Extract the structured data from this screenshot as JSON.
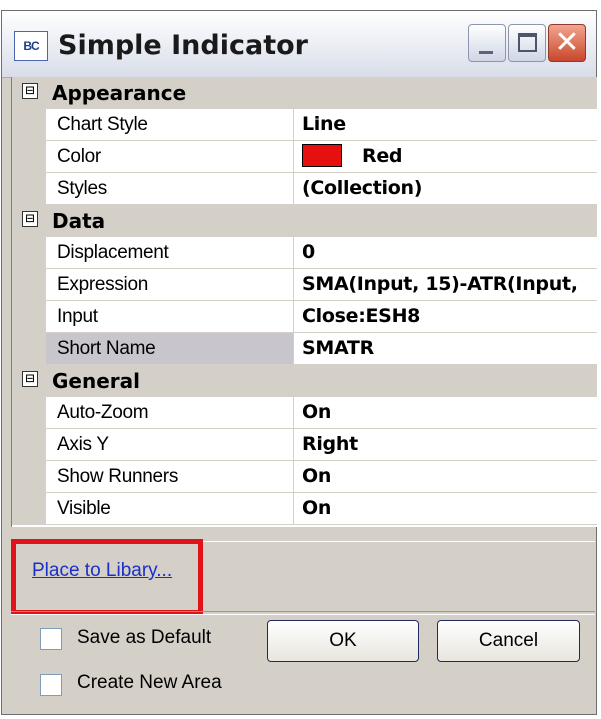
{
  "window": {
    "title": "Simple Indicator",
    "icon_text": "BC",
    "icon": "indicator-app-icon"
  },
  "grid": {
    "categories": [
      {
        "label": "Appearance",
        "expander": "⊟",
        "properties": [
          {
            "name": "Chart Style",
            "value": "Line"
          },
          {
            "name": "Color",
            "value": "Red",
            "swatch": "#e61010"
          },
          {
            "name": "Styles",
            "value": "(Collection)"
          }
        ]
      },
      {
        "label": "Data",
        "expander": "⊟",
        "properties": [
          {
            "name": "Displacement",
            "value": "0"
          },
          {
            "name": "Expression",
            "value": "SMA(Input, 15)-ATR(Input,"
          },
          {
            "name": "Input",
            "value": "Close:ESH8"
          },
          {
            "name": "Short Name",
            "value": "SMATR",
            "selected": true
          }
        ]
      },
      {
        "label": "General",
        "expander": "⊟",
        "properties": [
          {
            "name": "Auto-Zoom",
            "value": "On"
          },
          {
            "name": "Axis Y",
            "value": "Right"
          },
          {
            "name": "Show Runners",
            "value": "On"
          },
          {
            "name": "Visible",
            "value": "On"
          }
        ]
      }
    ]
  },
  "link": {
    "text": "Place to Libary..."
  },
  "checkboxes": {
    "save_default": {
      "label": "Save as Default",
      "checked": false
    },
    "create_area": {
      "label": "Create New Area",
      "checked": false
    }
  },
  "buttons": {
    "ok": "OK",
    "cancel": "Cancel"
  },
  "colors": {
    "highlight": "#e0131b",
    "link": "#1c2ec8",
    "dialog_bg": "#d4d0c8"
  }
}
